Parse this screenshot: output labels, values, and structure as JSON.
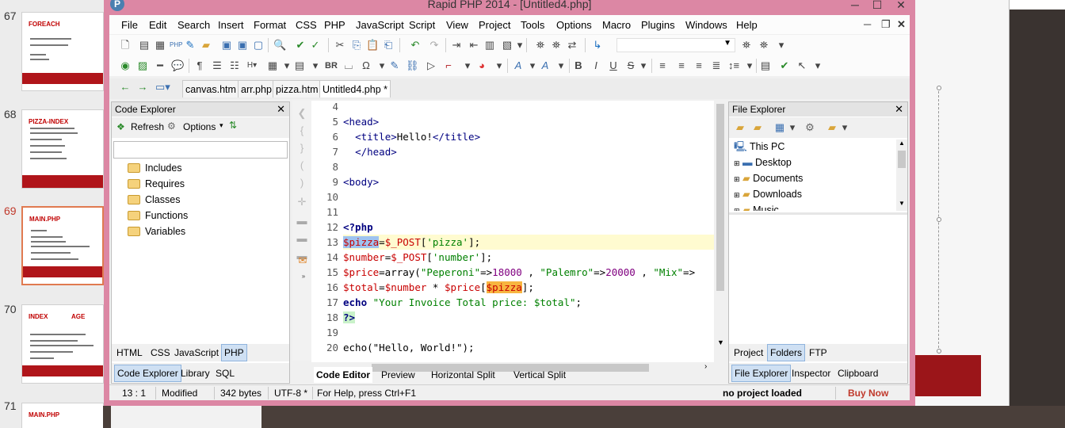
{
  "background": {
    "slides": [
      {
        "num": "67",
        "title": "FOREACH",
        "title2": ""
      },
      {
        "num": "68",
        "title": "PIZZA-INDEX",
        "title2": ""
      },
      {
        "num": "69",
        "title": "MAIN.PHP",
        "title2": ""
      },
      {
        "num": "70",
        "title": "INDEX",
        "title2": "AGE"
      },
      {
        "num": "71",
        "title": "MAIN.PHP",
        "title2": ""
      }
    ],
    "accent": "#b0151a"
  },
  "window": {
    "title": "Rapid PHP 2014 - [Untitled4.php]",
    "frame_color": "#dc87a4",
    "app_icon": "P"
  },
  "menu": [
    "File",
    "Edit",
    "Search",
    "Insert",
    "Format",
    "CSS",
    "PHP",
    "JavaScript",
    "Script",
    "View",
    "Project",
    "Tools",
    "Options",
    "Macro",
    "Plugins",
    "Windows",
    "Help"
  ],
  "doc_tabs": [
    "canvas.htm",
    "arr.php",
    "pizza.htm",
    "Untitled4.php *"
  ],
  "code_explorer": {
    "title": "Code Explorer",
    "refresh": "Refresh",
    "options": "Options",
    "items": [
      "Includes",
      "Requires",
      "Classes",
      "Functions",
      "Variables"
    ],
    "lang_tabs": [
      "HTML",
      "CSS",
      "JavaScript",
      "PHP"
    ],
    "bottom_tabs": [
      "Code Explorer",
      "Library",
      "SQL"
    ]
  },
  "editor": {
    "line_numbers": [
      "4",
      "5",
      "6",
      "7",
      "8",
      "9",
      "10",
      "11",
      "12",
      "13",
      "14",
      "15",
      "16",
      "17",
      "18",
      "19",
      "20"
    ],
    "tabs": [
      "Code Editor",
      "Preview",
      "Horizontal Split",
      "Vertical Split"
    ]
  },
  "file_explorer": {
    "title": "File Explorer",
    "root": "This PC",
    "items": [
      "Desktop",
      "Documents",
      "Downloads",
      "Music"
    ],
    "tabs": [
      "Project",
      "Folders",
      "FTP"
    ],
    "bottom_tabs": [
      "File Explorer",
      "Inspector",
      "Clipboard"
    ]
  },
  "status": {
    "position": "13 : 1",
    "state": "Modified",
    "size": "342 bytes",
    "encoding": "UTF-8 *",
    "help": "For Help, press Ctrl+F1",
    "project": "no project loaded",
    "buy": "Buy Now"
  }
}
